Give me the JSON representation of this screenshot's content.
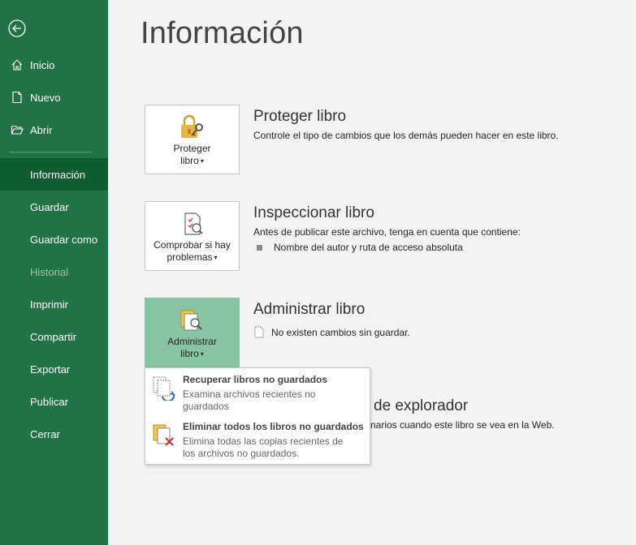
{
  "sidebar": {
    "top_items": [
      {
        "label": "Inicio",
        "icon": "home-icon"
      },
      {
        "label": "Nuevo",
        "icon": "new-document-icon"
      },
      {
        "label": "Abrir",
        "icon": "open-folder-icon"
      }
    ],
    "items": [
      {
        "label": "Información",
        "active": true
      },
      {
        "label": "Guardar"
      },
      {
        "label": "Guardar como"
      },
      {
        "label": "Historial",
        "disabled": true
      },
      {
        "label": "Imprimir"
      },
      {
        "label": "Compartir"
      },
      {
        "label": "Exportar"
      },
      {
        "label": "Publicar"
      },
      {
        "label": "Cerrar"
      }
    ]
  },
  "main": {
    "title": "Información",
    "sections": {
      "protect": {
        "tile_label_1": "Proteger",
        "tile_label_2": "libro",
        "title": "Proteger libro",
        "desc": "Controle el tipo de cambios que los demás pueden hacer en este libro."
      },
      "inspect": {
        "tile_label_1": "Comprobar si hay",
        "tile_label_2": "problemas",
        "title": "Inspeccionar libro",
        "desc": "Antes de publicar este archivo, tenga en cuenta que contiene:",
        "bullet": "Nombre del autor y ruta de acceso absoluta"
      },
      "manage": {
        "tile_label_1": "Administrar",
        "tile_label_2": "libro",
        "title": "Administrar libro",
        "desc": "No existen cambios sin guardar."
      },
      "browser": {
        "title_partial": "de explorador",
        "desc_partial": "narios cuando este libro se vea en la Web."
      }
    },
    "dropdown": {
      "items": [
        {
          "title": "Recuperar libros no guardados",
          "desc": "Examina archivos recientes no guardados"
        },
        {
          "title": "Eliminar todos los libros no guardados",
          "desc": "Elimina todas las copias recientes de los archivos no guardados."
        }
      ]
    }
  },
  "colors": {
    "sidebar": "#217346",
    "sidebar_active": "#0e5c2f",
    "tile_selected": "#88c4a1"
  }
}
